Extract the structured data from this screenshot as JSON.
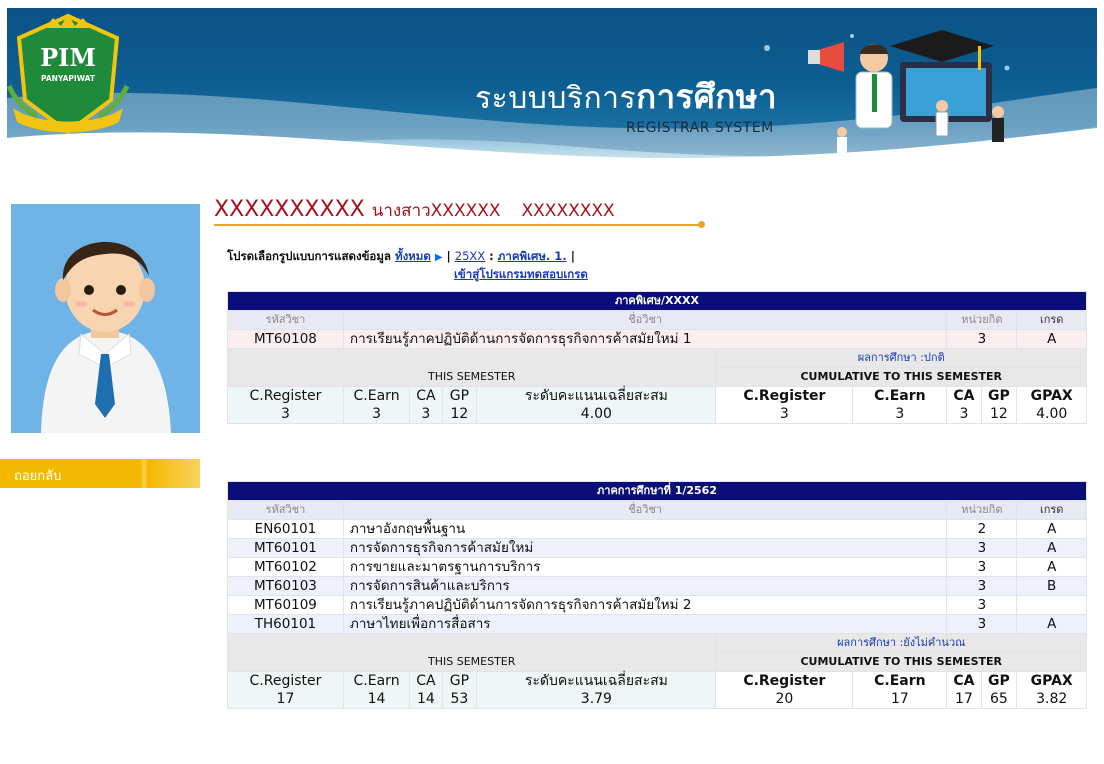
{
  "banner": {
    "title_regular": "ระบบบริการ",
    "title_bold": "การศึกษา",
    "subtitle": "REGISTRAR SYSTEM",
    "logo_text": "PIM",
    "logo_sub": "PANYAPIWAT"
  },
  "student": {
    "id": "XXXXXXXXXX",
    "name": "นางสาวXXXXXX",
    "surname": "XXXXXXXX"
  },
  "sidebar": {
    "back_label": "ถอยกลับ"
  },
  "selector": {
    "prompt": "โปรดเลือกรูปแบบการแสดงข้อมูล",
    "all_link": "ทั้งหมด",
    "sep1": "|",
    "year_link": "25XX",
    "colon": ":",
    "term_link": "ภาคพิเศษ. 1.",
    "sep2": "|",
    "test_link": "เข้าสู่โปรแกรมทดสอบเกรด"
  },
  "columns": {
    "code": "รหัสวิชา",
    "name": "ชื่อวิชา",
    "credit": "หน่วยกิต",
    "grade": "เกรด"
  },
  "summary_labels": {
    "this_semester": "THIS SEMESTER",
    "cumulative": "CUMULATIVE TO THIS SEMESTER",
    "c_register": "C.Register",
    "c_earn": "C.Earn",
    "ca": "CA",
    "gp": "GP",
    "gpa_th": "ระดับคะแนนเฉลี่ยสะสม",
    "gpax": "GPAX"
  },
  "semesters": [
    {
      "title": "ภาคพิเศษ/XXXX",
      "courses": [
        {
          "code": "MT60108",
          "name": "การเรียนรู้ภาคปฏิบัติด้านการจัดการธุรกิจการค้าสมัยใหม่ 1",
          "credit": "3",
          "grade": "A"
        }
      ],
      "status": "ผลการศึกษา :ปกติ",
      "sem": {
        "c_register": "3",
        "c_earn": "3",
        "ca": "3",
        "gp": "12",
        "gpa": "4.00"
      },
      "cum": {
        "c_register": "3",
        "c_earn": "3",
        "ca": "3",
        "gp": "12",
        "gpax": "4.00"
      }
    },
    {
      "title": "ภาคการศึกษาที่ 1/2562",
      "courses": [
        {
          "code": "EN60101",
          "name": "ภาษาอังกฤษพื้นฐาน",
          "credit": "2",
          "grade": "A"
        },
        {
          "code": "MT60101",
          "name": "การจัดการธุรกิจการค้าสมัยใหม่",
          "credit": "3",
          "grade": "A"
        },
        {
          "code": "MT60102",
          "name": "การขายและมาตรฐานการบริการ",
          "credit": "3",
          "grade": "A"
        },
        {
          "code": "MT60103",
          "name": "การจัดการสินค้าและบริการ",
          "credit": "3",
          "grade": "B"
        },
        {
          "code": "MT60109",
          "name": "การเรียนรู้ภาคปฏิบัติด้านการจัดการธุรกิจการค้าสมัยใหม่ 2",
          "credit": "3",
          "grade": ""
        },
        {
          "code": "TH60101",
          "name": "ภาษาไทยเพื่อการสื่อสาร",
          "credit": "3",
          "grade": "A"
        }
      ],
      "status": "ผลการศึกษา :ยังไม่คำนวณ",
      "sem": {
        "c_register": "17",
        "c_earn": "14",
        "ca": "14",
        "gp": "53",
        "gpa": "3.79"
      },
      "cum": {
        "c_register": "20",
        "c_earn": "17",
        "ca": "17",
        "gp": "65",
        "gpax": "3.82"
      }
    }
  ]
}
